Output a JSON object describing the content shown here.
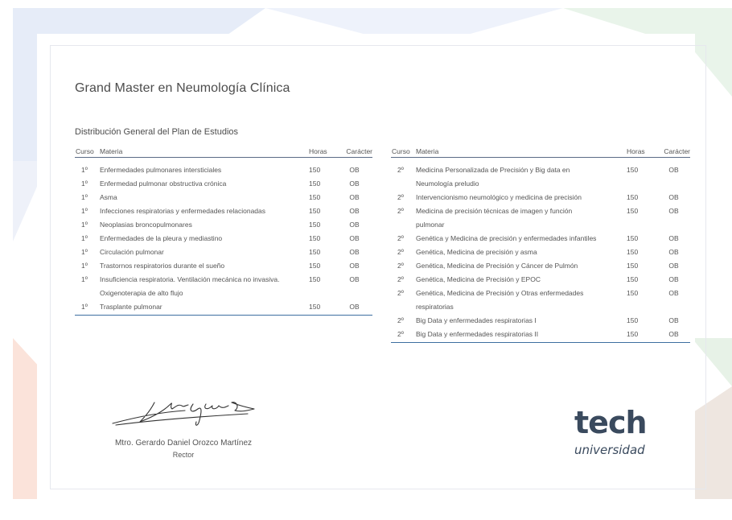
{
  "title": "Grand Master en Neumología Clínica",
  "subtitle": "Distribución General del Plan de Estudios",
  "table_headers": {
    "curso": "Curso",
    "materia": "Materia",
    "horas": "Horas",
    "caracter": "Carácter"
  },
  "left_rows": [
    {
      "curso": "1º",
      "materia": [
        "Enfermedades pulmonares intersticiales"
      ],
      "horas": "150",
      "caracter": "OB"
    },
    {
      "curso": "1º",
      "materia": [
        "Enfermedad pulmonar obstructiva crónica"
      ],
      "horas": "150",
      "caracter": "OB"
    },
    {
      "curso": "1º",
      "materia": [
        "Asma"
      ],
      "horas": "150",
      "caracter": "OB"
    },
    {
      "curso": "1º",
      "materia": [
        "Infecciones respiratorias y enfermedades relacionadas"
      ],
      "horas": "150",
      "caracter": "OB"
    },
    {
      "curso": "1º",
      "materia": [
        "Neoplasias broncopulmonares"
      ],
      "horas": "150",
      "caracter": "OB"
    },
    {
      "curso": "1º",
      "materia": [
        "Enfermedades de la pleura y mediastino"
      ],
      "horas": "150",
      "caracter": "OB"
    },
    {
      "curso": "1º",
      "materia": [
        "Circulación pulmonar"
      ],
      "horas": "150",
      "caracter": "OB"
    },
    {
      "curso": "1º",
      "materia": [
        "Trastornos respiratorios durante el sueño"
      ],
      "horas": "150",
      "caracter": "OB"
    },
    {
      "curso": "1º",
      "materia": [
        "Insuficiencia respiratoria. Ventilación mecánica no invasiva.",
        "Oxigenoterapia de alto flujo"
      ],
      "horas": "150",
      "caracter": "OB"
    },
    {
      "curso": "1º",
      "materia": [
        "Trasplante pulmonar"
      ],
      "horas": "150",
      "caracter": "OB"
    }
  ],
  "right_rows": [
    {
      "curso": "2º",
      "materia": [
        "Medicina Personalizada de Precisión y Big data en",
        "Neumología preludio"
      ],
      "horas": "150",
      "caracter": "OB"
    },
    {
      "curso": "2º",
      "materia": [
        "Intervencionismo neumológico y medicina de precisión"
      ],
      "horas": "150",
      "caracter": "OB"
    },
    {
      "curso": "2º",
      "materia": [
        "Medicina de precisión técnicas de imagen y función",
        "pulmonar"
      ],
      "horas": "150",
      "caracter": "OB"
    },
    {
      "curso": "2º",
      "materia": [
        "Genética y Medicina de precisión y enfermedades infantiles"
      ],
      "horas": "150",
      "caracter": "OB"
    },
    {
      "curso": "2º",
      "materia": [
        "Genética, Medicina de precisión y asma"
      ],
      "horas": "150",
      "caracter": "OB"
    },
    {
      "curso": "2º",
      "materia": [
        "Genética, Medicina de Precisión y Cáncer de Pulmón"
      ],
      "horas": "150",
      "caracter": "OB"
    },
    {
      "curso": "2º",
      "materia": [
        "Genética, Medicina de Precisión y EPOC"
      ],
      "horas": "150",
      "caracter": "OB"
    },
    {
      "curso": "2º",
      "materia": [
        "Genética, Medicina de Precisión y Otras enfermedades",
        "respiratorias"
      ],
      "horas": "150",
      "caracter": "OB"
    },
    {
      "curso": "2º",
      "materia": [
        "Big Data y enfermedades respiratorias I"
      ],
      "horas": "150",
      "caracter": "OB"
    },
    {
      "curso": "2º",
      "materia": [
        "Big Data y enfermedades respiratorias II"
      ],
      "horas": "150",
      "caracter": "OB"
    }
  ],
  "signature": {
    "name": "Mtro. Gerardo Daniel Orozco Martínez",
    "role": "Rector"
  },
  "logo": {
    "brand": "tech",
    "subtext": "universidad",
    "color": "#3a4a5e",
    "accent": "#3d6fa0"
  }
}
